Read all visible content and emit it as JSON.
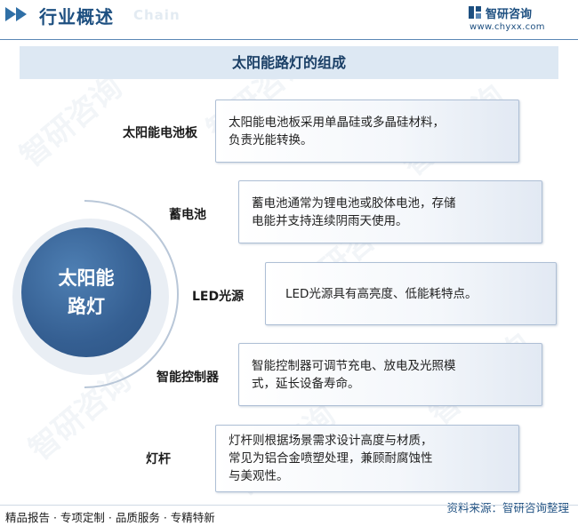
{
  "header": {
    "title": "行业概述",
    "ghost": "Chain",
    "logo_name": "智研咨询",
    "logo_url": "www.chyxx.com"
  },
  "diagram_title": "太阳能路灯的组成",
  "center": {
    "label": "太阳能路灯"
  },
  "components": [
    {
      "name": "太阳能电池板",
      "desc": [
        "太阳能电池板采用单晶硅或多晶硅材料，",
        "负责光能转换。"
      ]
    },
    {
      "name": "蓄电池",
      "desc": [
        "蓄电池通常为锂电池或胶体电池，存储",
        "电能并支持连续阴雨天使用。"
      ]
    },
    {
      "name": "LED光源",
      "desc": [
        "LED光源具有高亮度、低能耗特点。"
      ]
    },
    {
      "name": "智能控制器",
      "desc": [
        "智能控制器可调节充电、放电及光照模",
        "式，延长设备寿命。"
      ]
    },
    {
      "name": "灯杆",
      "desc": [
        "灯杆则根据场景需求设计高度与材质，",
        "常见为铝合金喷塑处理，兼顾耐腐蚀性",
        "与美观性。"
      ]
    }
  ],
  "footer": {
    "slogan": "精品报告 · 专项定制 · 品质服务 · 专精特新",
    "source": "资料来源：智研咨询整理"
  },
  "watermark": "智研咨询",
  "colors": {
    "primary": "#2f6fa6",
    "circle": "#355f92",
    "titlebar": "#dde8f3"
  }
}
